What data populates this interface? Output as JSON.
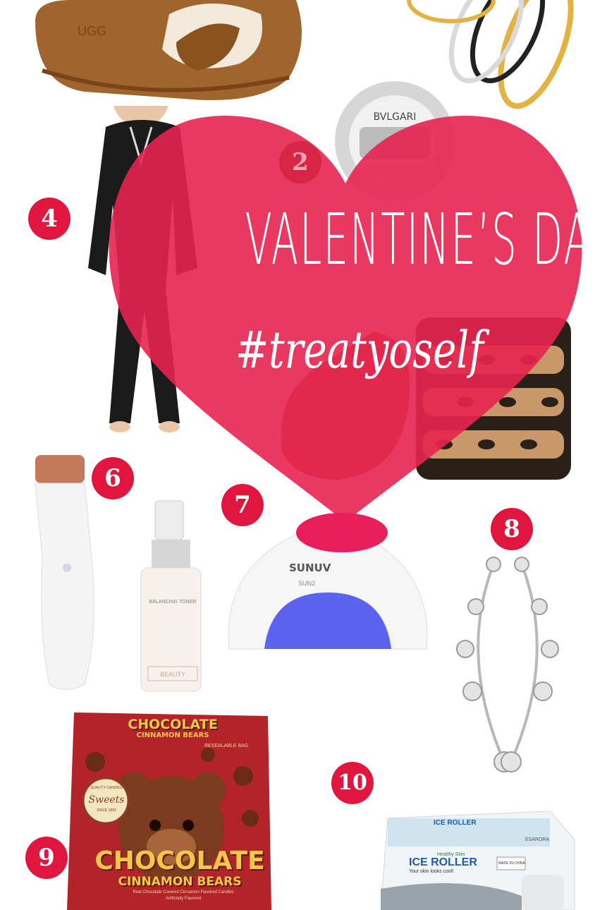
{
  "title": "VALENTINE’S DAY",
  "hashtag": "#treatyoself",
  "badges": [
    "2",
    "4",
    "6",
    "7",
    "8",
    "9",
    "10"
  ],
  "products": {
    "slipper_brand": "UGG",
    "perfume_brand": "BVLGARI",
    "lamp_brand": "SUNUV",
    "lamp_model": "SUN2",
    "toner_brand": "BEAUTY",
    "toner_label": "BALANCING TONER",
    "candy_top_title": "CHOCOLATE",
    "candy_top_sub": "CINNAMON BEARS",
    "candy_bag_note": "RESEALABLE BAG",
    "candy_brand": "Sweets",
    "candy_seal_top": "QUALITY CANDIES",
    "candy_seal_bottom": "SINCE 1892",
    "candy_main_title": "CHOCOLATE",
    "candy_main_sub": "CINNAMON BEARS",
    "candy_desc": "Real Chocolate Covered Cinnamon Flavored Candies",
    "candy_desc2": "Artificially Flavored",
    "roller_brand": "ICE ROLLER",
    "roller_tag": "Healthy Skin",
    "roller_slogan": "Your skin looks cool!",
    "roller_made": "MADE IN CHINA",
    "roller_seller": "ESARORA"
  },
  "colors": {
    "accent": "#e0163f",
    "heart": "#e8234f"
  }
}
